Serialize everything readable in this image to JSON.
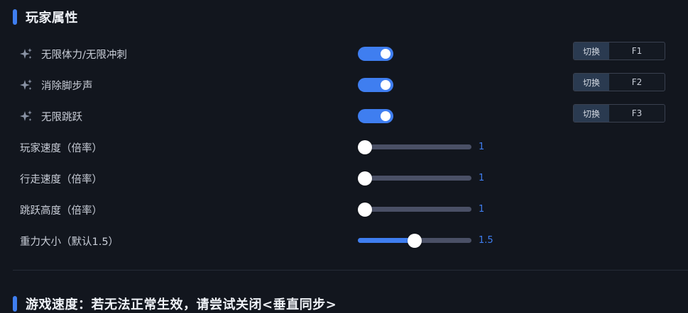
{
  "colors": {
    "accent": "#3f7ef0",
    "background": "#12161e",
    "track": "#4a5066"
  },
  "player_section": {
    "title": "玩家属性",
    "toggles": [
      {
        "label": "无限体力/无限冲刺",
        "enabled": true,
        "switch_label": "切换",
        "hotkey": "F1",
        "icon": "sparkle-icon"
      },
      {
        "label": "消除脚步声",
        "enabled": true,
        "switch_label": "切换",
        "hotkey": "F2",
        "icon": "sparkle-icon"
      },
      {
        "label": "无限跳跃",
        "enabled": true,
        "switch_label": "切换",
        "hotkey": "F3",
        "icon": "sparkle-icon"
      }
    ],
    "sliders": [
      {
        "label": "玩家速度（倍率）",
        "value": "1",
        "fraction": 0.0
      },
      {
        "label": "行走速度（倍率）",
        "value": "1",
        "fraction": 0.0
      },
      {
        "label": "跳跃高度（倍率）",
        "value": "1",
        "fraction": 0.0
      },
      {
        "label": "重力大小（默认1.5）",
        "value": "1.5",
        "fraction": 0.5
      }
    ]
  },
  "game_speed_section": {
    "title": "游戏速度：若无法正常生效，请尝试关闭<垂直同步>"
  }
}
